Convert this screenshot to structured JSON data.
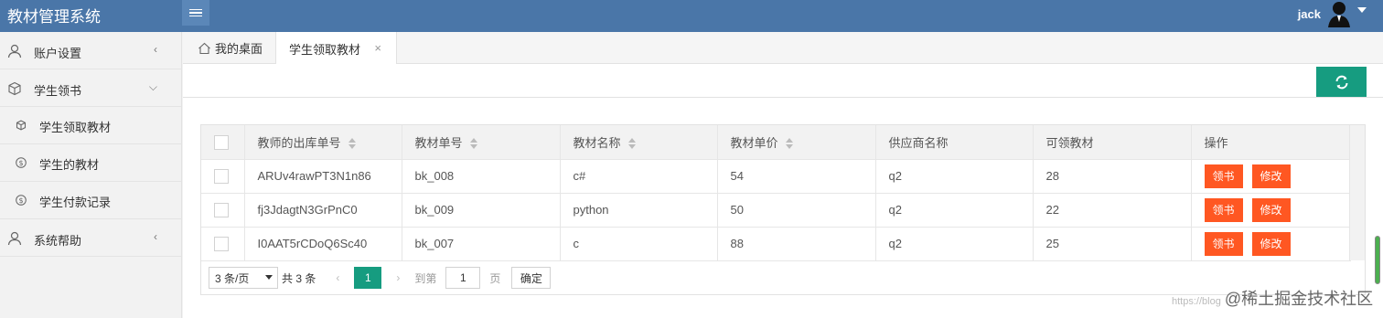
{
  "app": {
    "title": "教材管理系统"
  },
  "header": {
    "username": "jack"
  },
  "sidebar": {
    "items": [
      {
        "label": "账户设置",
        "icon": "user-icon"
      },
      {
        "label": "学生领书",
        "icon": "cube-icon"
      },
      {
        "label": "学生领取教材",
        "icon": "cube-icon"
      },
      {
        "label": "学生的教材",
        "icon": "dollar-icon"
      },
      {
        "label": "学生付款记录",
        "icon": "dollar-icon"
      },
      {
        "label": "系统帮助",
        "icon": "user-icon"
      }
    ]
  },
  "tabs": {
    "home": "我的桌面",
    "active": "学生领取教材",
    "close": "×"
  },
  "table": {
    "columns": [
      "教师的出库单号",
      "教材单号",
      "教材名称",
      "教材单价",
      "供应商名称",
      "可领教材",
      "操作"
    ],
    "rows": [
      {
        "order": "ARUv4rawPT3N1n86",
        "book_id": "bk_008",
        "name": "c#",
        "price": "54",
        "supplier": "q2",
        "available": "28"
      },
      {
        "order": "fj3JdagtN3GrPnC0",
        "book_id": "bk_009",
        "name": "python",
        "price": "50",
        "supplier": "q2",
        "available": "22"
      },
      {
        "order": "I0AAT5rCDoQ6Sc40",
        "book_id": "bk_007",
        "name": "c",
        "price": "88",
        "supplier": "q2",
        "available": "25"
      }
    ],
    "actions": {
      "receive": "领书",
      "edit": "修改"
    }
  },
  "pager": {
    "page_size": "3 条/页",
    "total": "共 3 条",
    "current": "1",
    "goto_label": "到第",
    "goto_value": "1",
    "page_unit": "页",
    "confirm": "确定"
  },
  "watermark": {
    "text": "@稀土掘金技术社区",
    "faint": "https://blog"
  },
  "colors": {
    "header": "#4a76a8",
    "accent": "#169c80",
    "danger": "#ff5722"
  }
}
